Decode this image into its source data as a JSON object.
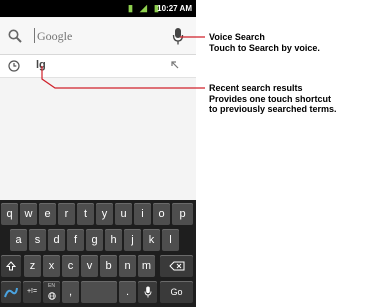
{
  "status_bar": {
    "time": "10:27 AM"
  },
  "search": {
    "placeholder": "Google"
  },
  "recent": {
    "text": "lg"
  },
  "keyboard": {
    "row1": [
      "q",
      "w",
      "e",
      "r",
      "t",
      "y",
      "u",
      "i",
      "o",
      "p"
    ],
    "row2": [
      "a",
      "s",
      "d",
      "f",
      "g",
      "h",
      "j",
      "k",
      "l"
    ],
    "row3": [
      "z",
      "x",
      "c",
      "v",
      "b",
      "n",
      "m"
    ],
    "sym_label": "+!=",
    "lang_label": "EN",
    "go_label": "Go",
    "comma": ",",
    "period": "."
  },
  "callouts": {
    "voice": [
      "Voice Search",
      "Touch to Search by voice."
    ],
    "recent": [
      "Recent search results",
      "Provides one touch shortcut",
      "to previously searched terms."
    ]
  },
  "colors": {
    "callout_line": "#d0202a",
    "keyboard_bg": "#1e1e1e",
    "key_bg": "#4e4e4e"
  }
}
